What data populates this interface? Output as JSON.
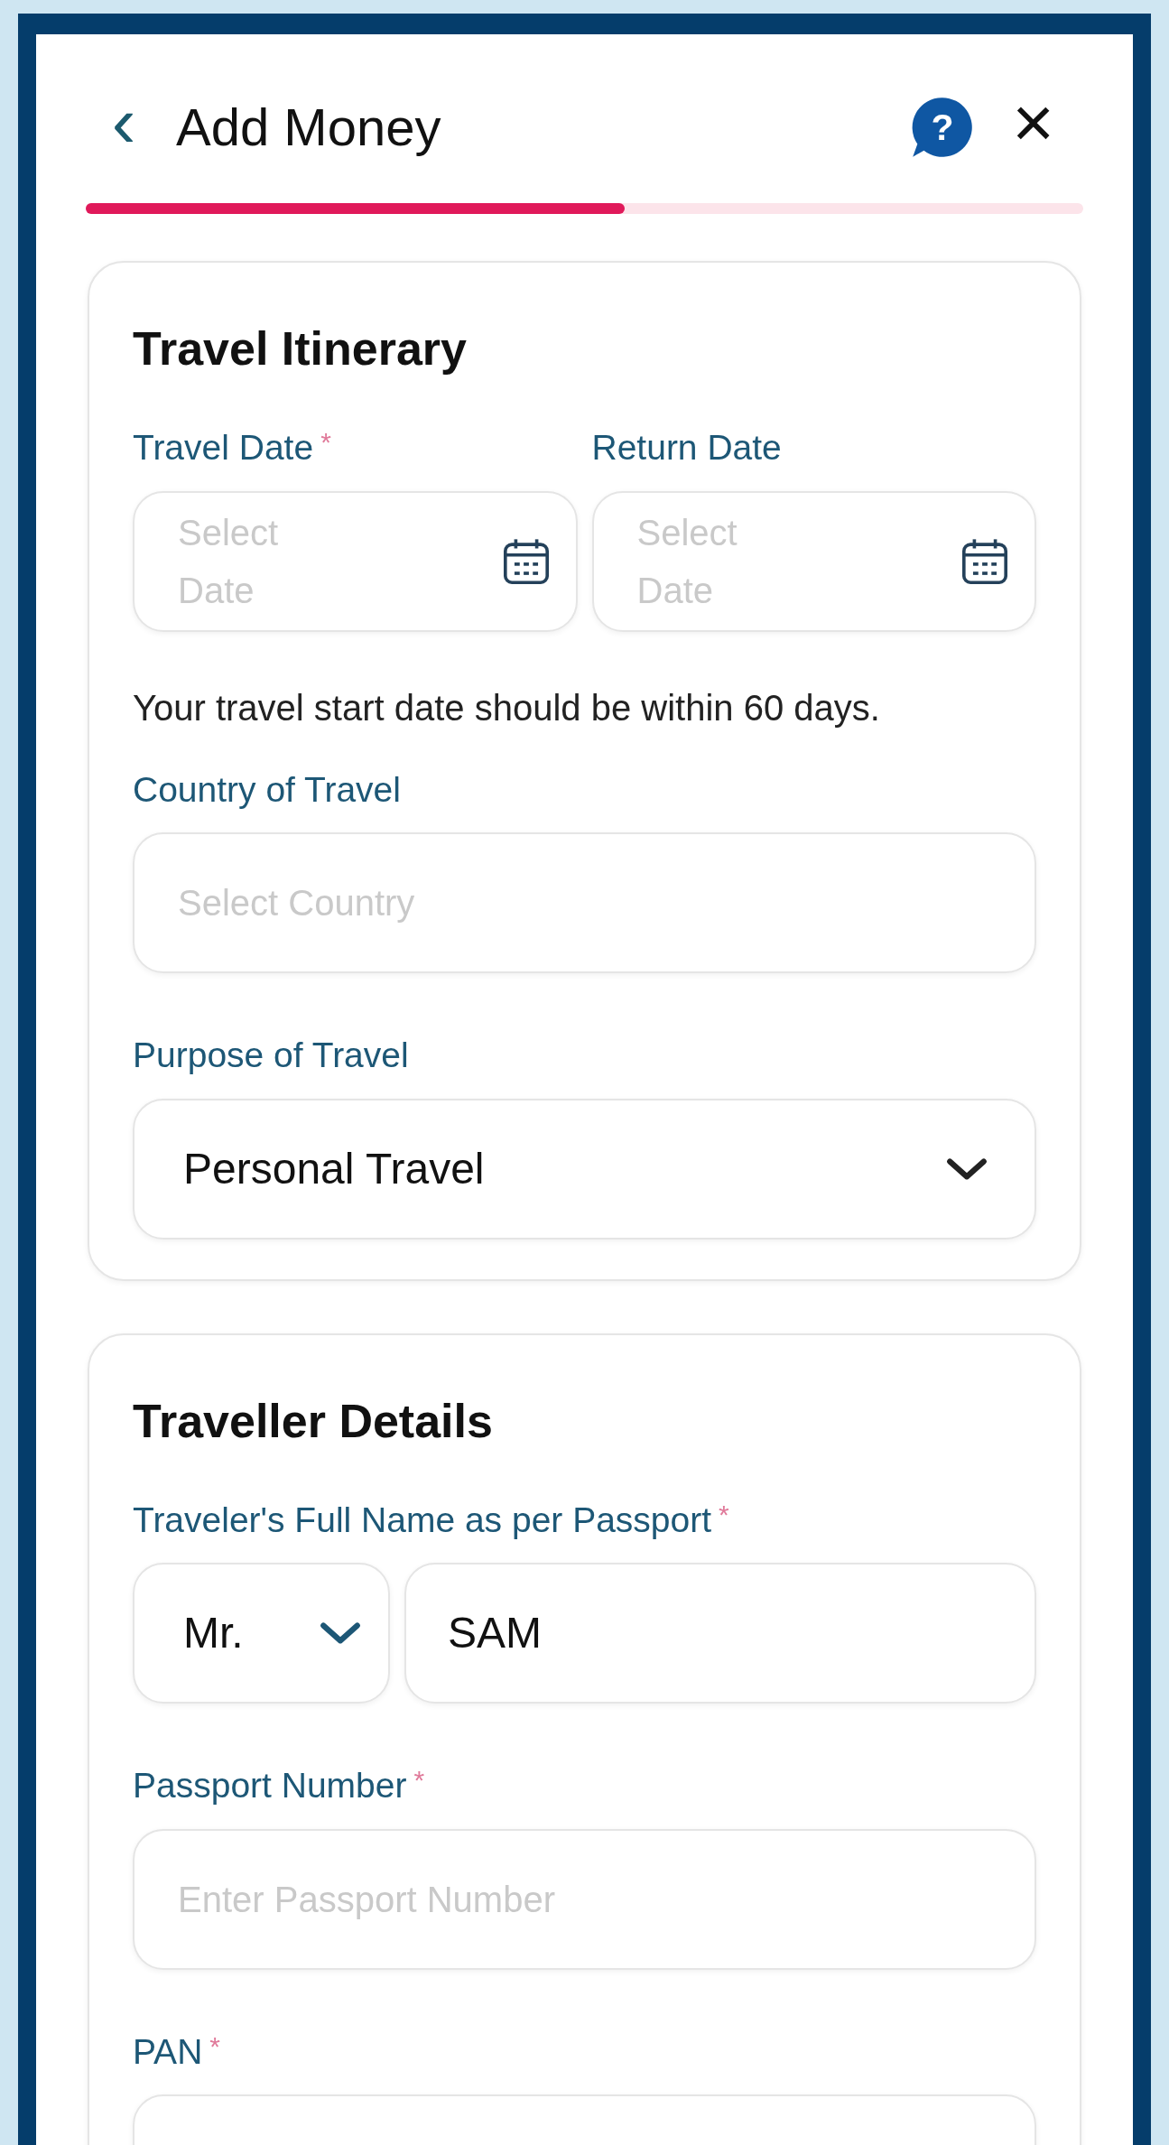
{
  "header": {
    "back": "‹",
    "title": "Add Money",
    "help": "?",
    "close": "×"
  },
  "progress": {
    "level": 0.54
  },
  "sections": [
    {
      "title": "Travel Itinerary",
      "blocks": [
        {
          "kind": "date_pair",
          "fields": [
            {
              "label": "Travel Date",
              "required_mark": "*",
              "placeholder": "Select Date"
            },
            {
              "label": "Return Date",
              "placeholder": "Select Date"
            }
          ]
        },
        {
          "kind": "note",
          "text": "Your travel start date should be within 60 days."
        },
        {
          "kind": "field",
          "label": "Country of Travel",
          "placeholder": "Select Country"
        },
        {
          "kind": "dropdown",
          "label": "Purpose of Travel",
          "value": "Personal Travel"
        }
      ]
    },
    {
      "title": "Traveller Details",
      "blocks": [
        {
          "kind": "name",
          "label": "Traveler's Full Name as per Passport",
          "required_mark": "*",
          "salutation": "Mr.",
          "value": "SAM"
        },
        {
          "kind": "field",
          "label": "Passport Number",
          "required_mark": "*",
          "placeholder": "Enter Passport Number"
        },
        {
          "kind": "field",
          "label": "PAN",
          "required_mark": "*"
        }
      ]
    }
  ]
}
